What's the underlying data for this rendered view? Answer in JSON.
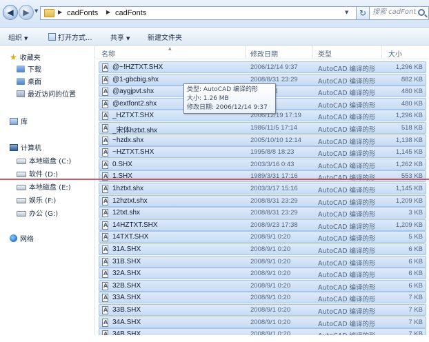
{
  "address_bar": {
    "path": [
      "cadFonts",
      "cadFonts"
    ],
    "search_placeholder": "搜索 cadFonts"
  },
  "toolbar": {
    "organize_label": "组织",
    "open_with_label": "打开方式...",
    "share_label": "共享",
    "new_folder_label": "新建文件夹"
  },
  "nav_pane": {
    "favorites": {
      "label": "收藏夹",
      "items": [
        {
          "label": "下载",
          "icon": "folder-download-icon"
        },
        {
          "label": "桌面",
          "icon": "desktop-icon"
        },
        {
          "label": "最近访问的位置",
          "icon": "recent-places-icon"
        }
      ]
    },
    "libraries_label": "库",
    "computer": {
      "label": "计算机",
      "drives": [
        "本地磁盘 (C:)",
        "软件 (D:)",
        "本地磁盘 (E:)",
        "娱乐 (F:)",
        "办公 (G:)"
      ]
    },
    "network_label": "网络"
  },
  "columns": {
    "name": "名称",
    "date": "修改日期",
    "type": "类型",
    "size": "大小"
  },
  "files": [
    {
      "name": "@~!HZTXT.SHX",
      "date": "2006/12/14 9:37",
      "type": "AutoCAD 编译的形",
      "size": "1,296 KB"
    },
    {
      "name": "@1-gbcbig.shx",
      "date": "2008/8/31 23:29",
      "type": "AutoCAD 编译的形",
      "size": "882 KB"
    },
    {
      "name": "@aygjpvt.shx",
      "date": "/14 10:02",
      "type": "AutoCAD 编译的形",
      "size": "480 KB"
    },
    {
      "name": "@extfont2.shx",
      "date": "3:05",
      "type": "AutoCAD 编译的形",
      "size": "480 KB"
    },
    {
      "name": "_HZTXT.SHX",
      "date": "2006/12/19 17:19",
      "type": "AutoCAD 编译的形",
      "size": "1,296 KB"
    },
    {
      "name": "_宋体hztxt.shx",
      "date": "1986/11/5 17:14",
      "type": "AutoCAD 编译的形",
      "size": "518 KB"
    },
    {
      "name": "~hzdx.shx",
      "date": "2005/10/10 12:14",
      "type": "AutoCAD 编译的形",
      "size": "1,138 KB"
    },
    {
      "name": "~HZTXT.SHX",
      "date": "1995/8/8 18:23",
      "type": "AutoCAD 编译的形",
      "size": "1,145 KB"
    },
    {
      "name": "0.SHX",
      "date": "2003/3/16 0:43",
      "type": "AutoCAD 编译的形",
      "size": "1,262 KB"
    },
    {
      "name": "1.SHX",
      "date": "1989/3/31 17:16",
      "type": "AutoCAD 编译的形",
      "size": "553 KB"
    },
    {
      "name": "1hztxt.shx",
      "date": "2003/3/17 15:16",
      "type": "AutoCAD 编译的形",
      "size": "1,145 KB"
    },
    {
      "name": "12hztxt.shx",
      "date": "2008/8/31 23:29",
      "type": "AutoCAD 编译的形",
      "size": "1,209 KB"
    },
    {
      "name": "12txt.shx",
      "date": "2008/8/31 23:29",
      "type": "AutoCAD 编译的形",
      "size": "3 KB"
    },
    {
      "name": "14HZTXT.SHX",
      "date": "2008/9/23 17:38",
      "type": "AutoCAD 编译的形",
      "size": "1,209 KB"
    },
    {
      "name": "14TXT.SHX",
      "date": "2008/9/1 0:20",
      "type": "AutoCAD 编译的形",
      "size": "5 KB"
    },
    {
      "name": "31A.SHX",
      "date": "2008/9/1 0:20",
      "type": "AutoCAD 编译的形",
      "size": "6 KB"
    },
    {
      "name": "31B.SHX",
      "date": "2008/9/1 0:20",
      "type": "AutoCAD 编译的形",
      "size": "6 KB"
    },
    {
      "name": "32A.SHX",
      "date": "2008/9/1 0:20",
      "type": "AutoCAD 编译的形",
      "size": "6 KB"
    },
    {
      "name": "32B.SHX",
      "date": "2008/9/1 0:20",
      "type": "AutoCAD 编译的形",
      "size": "6 KB"
    },
    {
      "name": "33A.SHX",
      "date": "2008/9/1 0:20",
      "type": "AutoCAD 编译的形",
      "size": "7 KB"
    },
    {
      "name": "33B.SHX",
      "date": "2008/9/1 0:20",
      "type": "AutoCAD 编译的形",
      "size": "7 KB"
    },
    {
      "name": "34A.SHX",
      "date": "2008/9/1 0:20",
      "type": "AutoCAD 编译的形",
      "size": "7 KB"
    },
    {
      "name": "34B.SHX",
      "date": "2008/9/1 0:20",
      "type": "AutoCAD 编译的形",
      "size": "7 KB"
    }
  ],
  "tooltip": {
    "type_line": "类型: AutoCAD 编译的形",
    "size_line": "大小: 1.26 MB",
    "date_line": "修改日期: 2006/12/14 9:37"
  },
  "colors": {
    "selection_fill": "#cfe0f7",
    "selection_border": "#a6c3e8",
    "overlay_line": "#c94045"
  }
}
